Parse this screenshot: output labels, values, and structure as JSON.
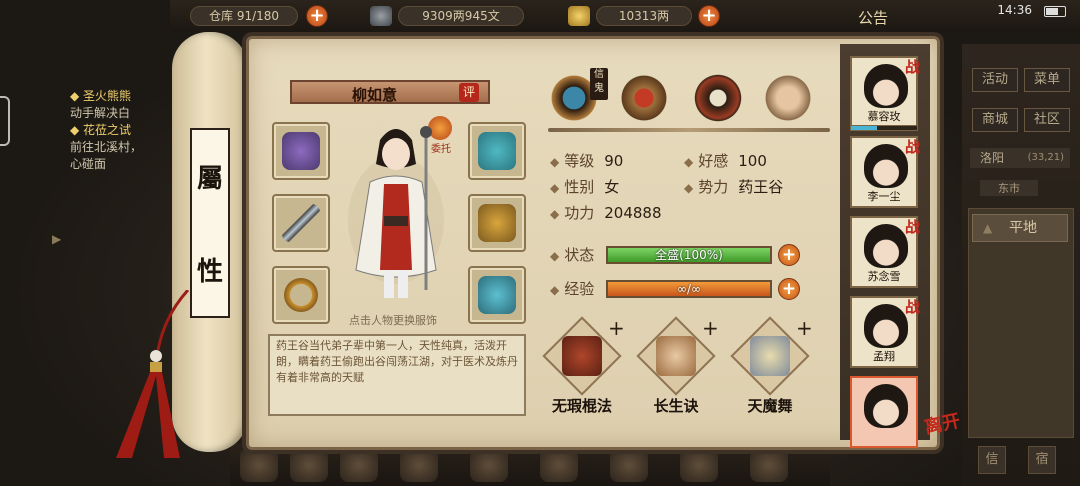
{
  "top_bar": {
    "storage_label": "仓库",
    "storage_count": "91/180",
    "money": "9309两945文",
    "silver": "10313两",
    "announcement": "公告",
    "time": "14:36"
  },
  "quests": [
    {
      "title": "圣火熊熊",
      "desc": "动手解决白"
    },
    {
      "title": "花莅之试",
      "desc": "前往北溪村，\n心碰面"
    }
  ],
  "scroll": {
    "title_top": "屬",
    "title_bottom": "性"
  },
  "character": {
    "name": "柳如意",
    "rate_badge": "评",
    "entrust_label": "委托",
    "hint": "点击人物更换服饰",
    "bio": "药王谷当代弟子辈中第一人，天性纯真，活泼开朗，瞒着药王偷跑出谷闯荡江湖，对于医术及炼丹有着非常高的天赋"
  },
  "top_icons": [
    "backpack-icon",
    "hat-icon",
    "taiji-icon",
    "meridian-figure-icon"
  ],
  "faith_label": "信\n鬼",
  "stats": {
    "level_label": "等级",
    "level": "90",
    "favor_label": "好感",
    "favor": "100",
    "gender_label": "性别",
    "gender": "女",
    "faction_label": "势力",
    "faction": "药王谷",
    "power_label": "功力",
    "power": "204888"
  },
  "bars": {
    "status_label": "状态",
    "status_text": "全盛(100%)",
    "status_fraction": 1.0,
    "exp_label": "经验",
    "exp_text": "∞/∞",
    "exp_fraction": 1.0
  },
  "skills": [
    {
      "name": "无瑕棍法",
      "plus": "+"
    },
    {
      "name": "长生诀",
      "plus": "+"
    },
    {
      "name": "天魔舞",
      "plus": "+"
    }
  ],
  "party": {
    "battle_tag": "战",
    "members": [
      "慕容玫",
      "李一尘",
      "苏念雪",
      "孟翔",
      ""
    ],
    "leave_label": "离开"
  },
  "right_menu": {
    "buttons": [
      "活动",
      "菜单",
      "商城",
      "社区"
    ],
    "location": "洛阳",
    "coords": "(33,21)",
    "sub_location": "东市",
    "terrain": "平地",
    "bottom_buttons": [
      "信",
      "宿"
    ]
  },
  "colors": {
    "status_bar": "#52b83a",
    "exp_bar": "#e27c26",
    "accent_red": "#c0241a",
    "parchment": "#e2d5b6"
  }
}
